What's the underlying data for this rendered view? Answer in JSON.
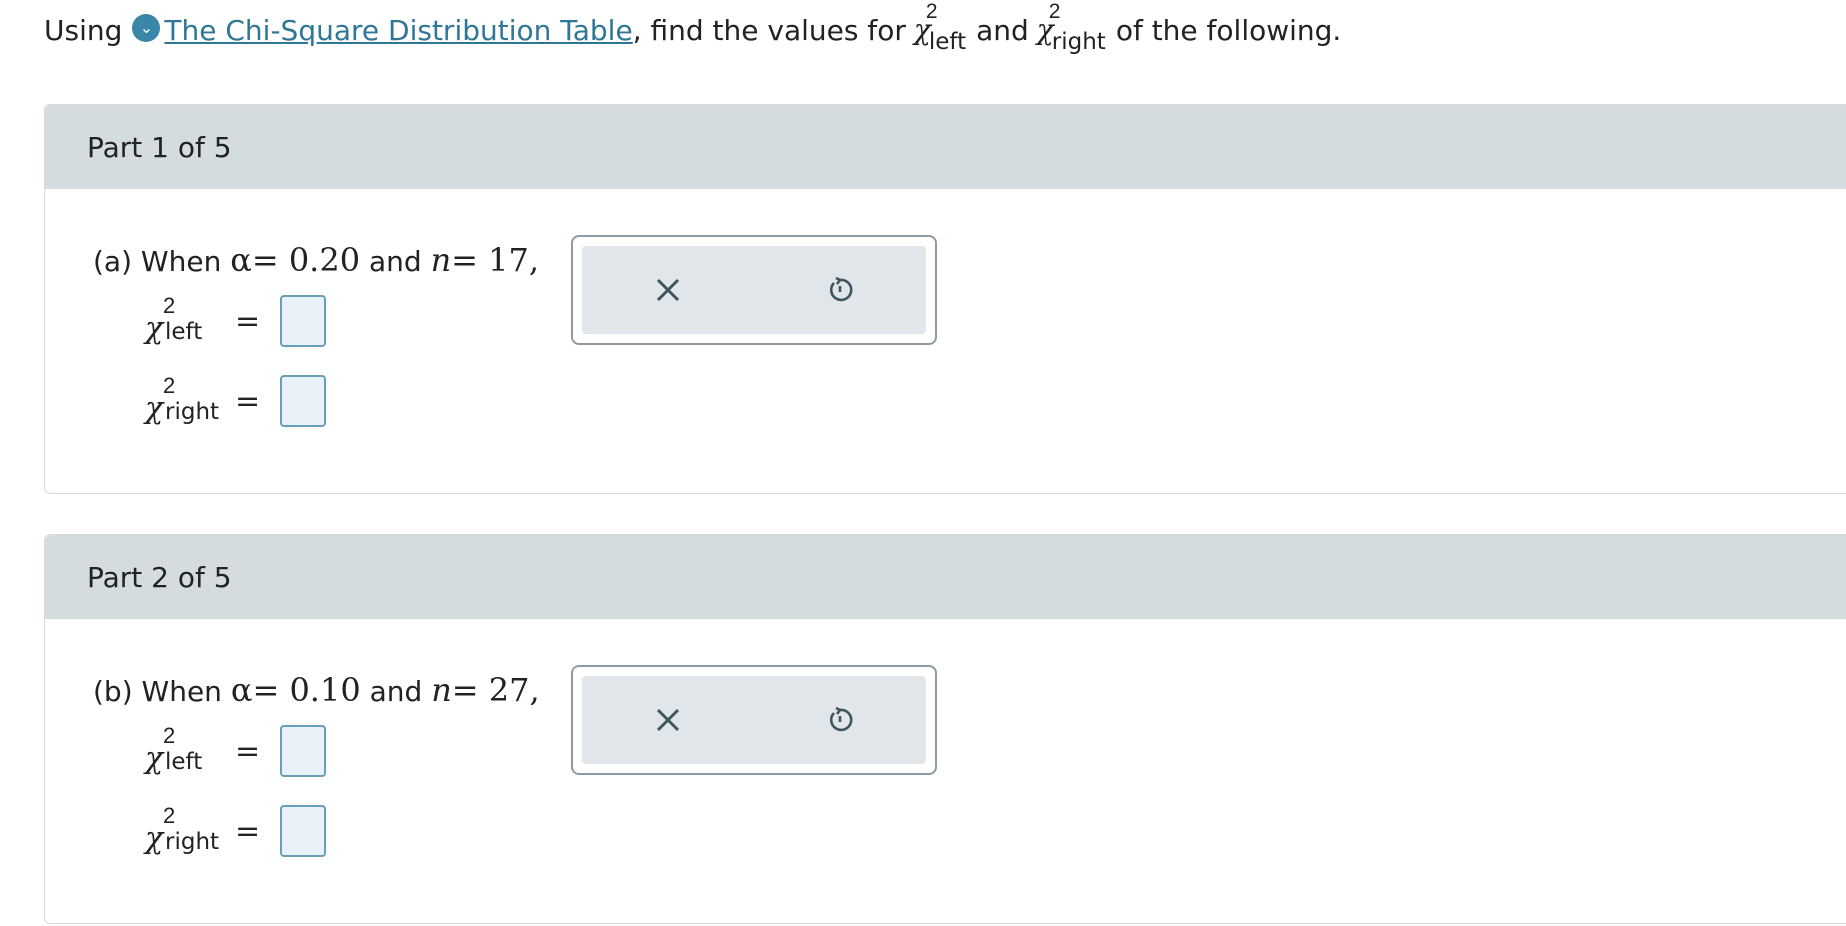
{
  "intro": {
    "prefix": "Using",
    "link_text": "The Chi-Square Distribution Table",
    "middle": ", find the values for",
    "chi_symbol": "χ",
    "exponent": "2",
    "left_sub": "left",
    "and_text": "and",
    "right_sub": "right",
    "suffix": "of the following.",
    "expand_glyph": "⌄"
  },
  "parts": [
    {
      "header": "Part 1 of 5",
      "label": "(a) When",
      "alpha_symbol": "α",
      "alpha_value": "= 0.20",
      "and_text": "and",
      "n_symbol": "n",
      "n_value": "= 17,",
      "rows": [
        {
          "chi": "χ",
          "exp": "2",
          "sub": "left",
          "eq": "=",
          "value": ""
        },
        {
          "chi": "χ",
          "exp": "2",
          "sub": "right",
          "eq": "=",
          "value": ""
        }
      ]
    },
    {
      "header": "Part 2 of 5",
      "label": "(b) When",
      "alpha_symbol": "α",
      "alpha_value": "= 0.10",
      "and_text": "and",
      "n_symbol": "n",
      "n_value": "= 27,",
      "rows": [
        {
          "chi": "χ",
          "exp": "2",
          "sub": "left",
          "eq": "=",
          "value": ""
        },
        {
          "chi": "χ",
          "exp": "2",
          "sub": "right",
          "eq": "=",
          "value": ""
        }
      ]
    }
  ],
  "tools": {
    "clear_icon": "close-icon",
    "reset_icon": "undo-icon"
  }
}
